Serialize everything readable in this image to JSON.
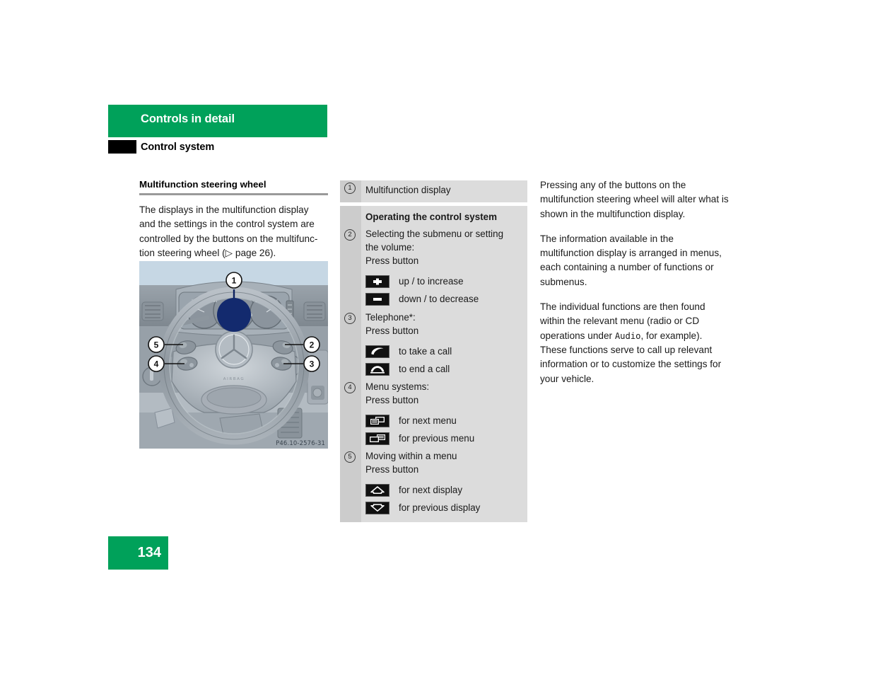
{
  "header": {
    "chapter_title": "Controls in detail",
    "section_title": "Control system",
    "band_color": "#00A15A"
  },
  "left_column": {
    "heading": "Multifunction steering wheel",
    "body_lines": [
      "The displays in the multifunction display",
      "and the settings in the control system are",
      "controlled by the buttons on the multifunc-",
      "tion steering wheel (▷ page 26)."
    ],
    "figure": {
      "code": "P46.10-2576-31",
      "callouts": [
        "1",
        "2",
        "3",
        "4",
        "5"
      ]
    }
  },
  "middle_column": {
    "item_1": {
      "marker": "1",
      "text": "Multifunction display"
    },
    "operating_heading": "Operating the control system",
    "item_2": {
      "marker": "2",
      "line1": "Selecting the submenu or setting",
      "line2": "the volume:",
      "line3": "Press button",
      "buttons": [
        {
          "icon": "plus-icon",
          "label": "up / to increase"
        },
        {
          "icon": "minus-icon",
          "label": "down / to decrease"
        }
      ]
    },
    "item_3": {
      "marker": "3",
      "line1": "Telephone*:",
      "line2": "Press button",
      "buttons": [
        {
          "icon": "phone-pickup-icon",
          "label": "to take a call"
        },
        {
          "icon": "phone-hangup-icon",
          "label": "to end a call"
        }
      ]
    },
    "item_4": {
      "marker": "4",
      "line1": "Menu systems:",
      "line2": "Press button",
      "buttons": [
        {
          "icon": "next-menu-icon",
          "label": "for next menu"
        },
        {
          "icon": "previous-menu-icon",
          "label": "for previous menu"
        }
      ]
    },
    "item_5": {
      "marker": "5",
      "line1": "Moving within a menu",
      "line2": "Press button",
      "buttons": [
        {
          "icon": "arrow-up-icon",
          "label": "for next display"
        },
        {
          "icon": "arrow-down-icon",
          "label": "for previous display"
        }
      ]
    }
  },
  "right_column": {
    "paragraph_1": "Pressing any of the buttons on the multifunction steering wheel will alter what is shown in the multifunction display.",
    "paragraph_2": "The information available in the multifunction display is arranged in menus, each containing a number of functions or submenus.",
    "paragraph_3_part_a": "The individual functions are then found within the relevant menu (radio or CD operations under ",
    "paragraph_3_mono": "Audio",
    "paragraph_3_part_b": ", for example). These functions serve to call up relevant information or to customize the settings for your vehicle."
  },
  "footer": {
    "page_number": "134"
  }
}
